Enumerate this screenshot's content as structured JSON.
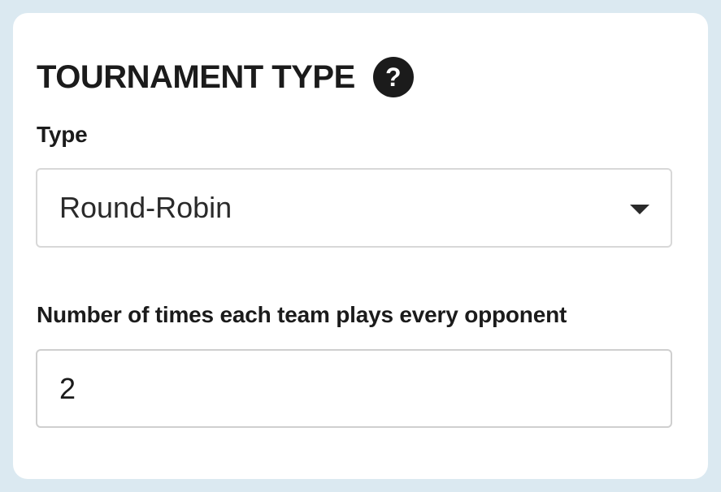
{
  "section": {
    "title": "TOURNAMENT TYPE",
    "help_glyph": "?"
  },
  "type_field": {
    "label": "Type",
    "selected": "Round-Robin"
  },
  "times_field": {
    "label": "Number of times each team plays every opponent",
    "value": "2"
  },
  "colors": {
    "background": "#dbe9f1",
    "card": "#ffffff",
    "text": "#1b1b1b",
    "border": "#d8d8d8"
  },
  "icons": {
    "help": "question-circle-icon",
    "dropdown": "caret-down-icon"
  }
}
